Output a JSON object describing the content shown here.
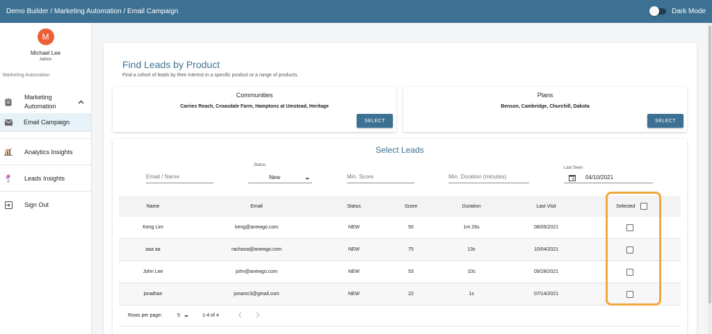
{
  "topbar": {
    "breadcrumb": "Demo Builder  /  Marketing Automation / Email Campaign",
    "dark_mode_label": "Dark Mode"
  },
  "user": {
    "initial": "M",
    "name": "Michael Lee",
    "role": "Admin"
  },
  "sidebar": {
    "section_label": "Marketing Automation",
    "marketing": "Marketing Automation",
    "items": [
      {
        "label": "Email Campaign",
        "icon": "mail-icon"
      },
      {
        "label": "Analytics Insights",
        "icon": "bar-chart-icon"
      },
      {
        "label": "Leads Insights",
        "icon": "leads-icon"
      },
      {
        "label": "Sign Out",
        "icon": "sign-out-icon"
      }
    ]
  },
  "find": {
    "title": "Find Leads by Product",
    "subtitle": "Find a cohort of leads by their interest in a specific product or a range of products.",
    "communities": {
      "title": "Communities",
      "values": "Carries Reach, Croasdale Farm, Hamptons at Umstead, Heritage",
      "button": "SELECT"
    },
    "plans": {
      "title": "Plans",
      "values": "Benson, Cambridge, Churchill, Dakota",
      "button": "SELECT"
    }
  },
  "leads": {
    "title": "Select Leads",
    "filters": {
      "email_placeholder": "Email / Name",
      "status_label": "Status",
      "status_value": "New",
      "score_placeholder": "Min. Score",
      "duration_placeholder": "Min. Duration (minutes)",
      "last_seen_label": "Last Seen",
      "last_seen_value": "04/10/2021"
    },
    "columns": [
      "Name",
      "Email",
      "Status",
      "Score",
      "Duration",
      "Last Visit",
      "Selected"
    ],
    "rows": [
      [
        "Keng Lim",
        "keng@anewgo.com",
        "NEW",
        "50",
        "1m 26s",
        "08/05/2021"
      ],
      [
        "aaa aa",
        "rachana@anewgo.com",
        "NEW",
        "75",
        "13s",
        "10/04/2021"
      ],
      [
        "John Lee",
        "john@anewgo.com",
        "NEW",
        "53",
        "10s",
        "09/28/2021"
      ],
      [
        "jonathan",
        "jonamc3@gmail.com",
        "NEW",
        "22",
        "1s",
        "07/14/2021"
      ]
    ],
    "footer": {
      "rows_label": "Rows per page:",
      "rows_value": "5",
      "range": "1-4 of 4"
    }
  },
  "colors": {
    "primary": "#3d7193",
    "highlight": "#f0a73a",
    "avatar": "#ea6034"
  }
}
